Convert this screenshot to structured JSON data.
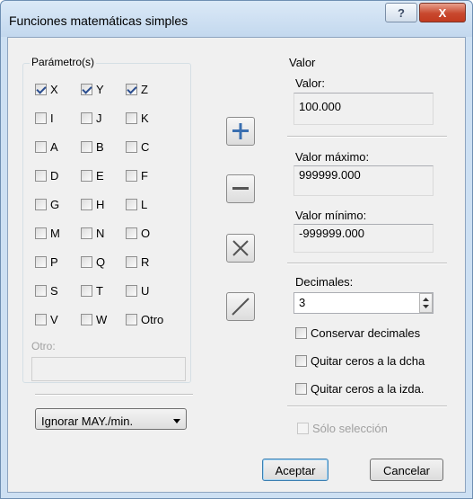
{
  "window": {
    "title": "Funciones matemáticas simples",
    "help_label": "?",
    "close_label": "X"
  },
  "parameters": {
    "legend": "Parámetro(s)",
    "rows": [
      [
        {
          "label": "X",
          "checked": true
        },
        {
          "label": "Y",
          "checked": true
        },
        {
          "label": "Z",
          "checked": true
        }
      ],
      [
        {
          "label": "I",
          "checked": false
        },
        {
          "label": "J",
          "checked": false
        },
        {
          "label": "K",
          "checked": false
        }
      ],
      [
        {
          "label": "A",
          "checked": false
        },
        {
          "label": "B",
          "checked": false
        },
        {
          "label": "C",
          "checked": false
        }
      ],
      [
        {
          "label": "D",
          "checked": false
        },
        {
          "label": "E",
          "checked": false
        },
        {
          "label": "F",
          "checked": false
        }
      ],
      [
        {
          "label": "G",
          "checked": false
        },
        {
          "label": "H",
          "checked": false
        },
        {
          "label": "L",
          "checked": false
        }
      ],
      [
        {
          "label": "M",
          "checked": false
        },
        {
          "label": "N",
          "checked": false
        },
        {
          "label": "O",
          "checked": false
        }
      ],
      [
        {
          "label": "P",
          "checked": false
        },
        {
          "label": "Q",
          "checked": false
        },
        {
          "label": "R",
          "checked": false
        }
      ],
      [
        {
          "label": "S",
          "checked": false
        },
        {
          "label": "T",
          "checked": false
        },
        {
          "label": "U",
          "checked": false
        }
      ],
      [
        {
          "label": "V",
          "checked": false
        },
        {
          "label": "W",
          "checked": false
        },
        {
          "label": "Otro",
          "checked": false
        }
      ]
    ],
    "other_label": "Otro:",
    "other_value": ""
  },
  "case_select": {
    "value": "Ignorar MAY./min."
  },
  "operations": {
    "icons": [
      "plus-icon",
      "minus-icon",
      "multiply-icon",
      "divide-icon"
    ],
    "accent_color": "#3a6fb0"
  },
  "valor": {
    "legend": "Valor",
    "value_label": "Valor:",
    "value": "100.000",
    "max_label": "Valor máximo:",
    "max_value": "999999.000",
    "min_label": "Valor mínimo:",
    "min_value": "-999999.000",
    "decimals_label": "Decimales:",
    "decimals_value": "3",
    "keep_decimals_label": "Conservar decimales",
    "trim_right_label": "Quitar ceros a la dcha",
    "trim_left_label": "Quitar ceros a la izda.",
    "selection_only_label": "Sólo selección"
  },
  "footer": {
    "accept_label": "Aceptar",
    "cancel_label": "Cancelar"
  }
}
